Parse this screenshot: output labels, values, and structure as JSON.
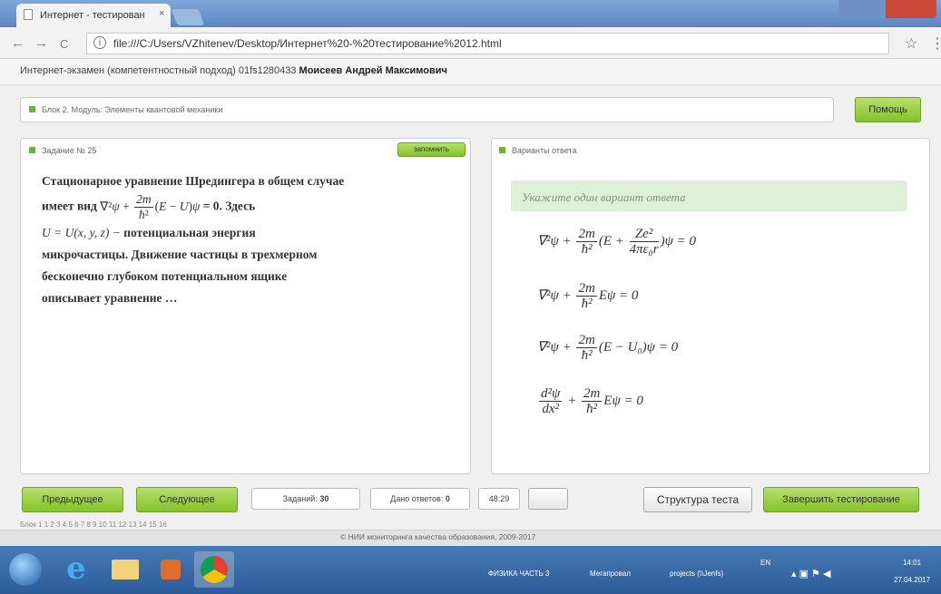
{
  "browser": {
    "tab_title": "Интернет - тестирован",
    "tab_close": "×",
    "url": "file:///C:/Users/VZhitenev/Desktop/Интернет%20-%20тестирование%2012.html",
    "info_glyph": "i",
    "back_glyph": "←",
    "forward_glyph": "→",
    "reload_glyph": "C",
    "star_glyph": "☆",
    "menu_glyph": "⋮"
  },
  "exam_header": {
    "prefix": "Интернет-экзамен (компетентностный подход) 01fs1280433",
    "student": "Моисеев Андрей Максимович"
  },
  "block": {
    "label": "Блок 2. Модуль: Элементы квантовой механики",
    "help_label": "Помощь"
  },
  "task_panel": {
    "title": "Задание № 25",
    "remember_label": "запомнить",
    "question": {
      "line1": "Стационарное уравнение Шредингера в общем случае",
      "line2_prefix": "имеет вид",
      "line2_suffix": "= 0. Здесь",
      "line3_math": "U = U(x, y, z) −",
      "line3_text": "потенциальная энергия",
      "line4": "микрочастицы. Движение частицы в трехмерном",
      "line5": "бесконечно глубоком потенциальном ящике",
      "line6": "описывает уравнение …"
    }
  },
  "answers_panel": {
    "title": "Варианты ответа",
    "hint": "Укажите один вариант ответа"
  },
  "bottom": {
    "prev_label": "Предыдущее",
    "next_label": "Следующее",
    "tasks_label": "Заданий:",
    "tasks_count": "30",
    "answered_label": "Дано ответов:",
    "answered_count": "0",
    "timer": "48:29",
    "structure_label": "Структура теста",
    "finish_label": "Завершить тестирование",
    "pager": "Блок 1  1  2  3  4  5  6  7  8  9  10  11  12  13  14  15  16"
  },
  "footer": {
    "text": "© НИИ мониторинга качества образования, 2009-2017"
  },
  "taskbar": {
    "item1": "ФИЗИКА  ЧАСТЬ 3",
    "item2": "Мегапровал",
    "item3": "projects (\\\\Jenfs)",
    "lang": "EN",
    "time": "14:01",
    "date": "27.04.2017"
  },
  "colors": {
    "accent_green": "#83c22b",
    "hint_bg": "#dff0d8",
    "taskbar": "#2c5d9a"
  }
}
